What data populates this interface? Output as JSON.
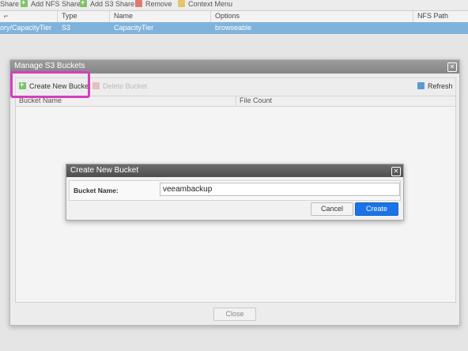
{
  "toolbar": {
    "items": [
      {
        "label": "Share",
        "icon": "none"
      },
      {
        "label": "Add NFS Share",
        "icon": "add-icon"
      },
      {
        "label": "Add S3 Share",
        "icon": "add-icon"
      },
      {
        "label": "Remove",
        "icon": "remove-icon"
      },
      {
        "label": "Context Menu",
        "icon": "menu-icon"
      }
    ]
  },
  "table": {
    "columns": [
      "⌐",
      "Type",
      "Name",
      "Options",
      "NFS Path"
    ],
    "rows": [
      {
        "path": "ory/CapacityTier",
        "type": "S3",
        "name": "CapacityTier",
        "options": "browseable",
        "nfs_path": ""
      }
    ]
  },
  "manage_dialog": {
    "title": "Manage S3 Buckets",
    "create_label": "Create New Bucket",
    "delete_label": "Delete Bucket",
    "refresh_label": "Refresh",
    "columns": [
      "Bucket Name",
      "File Count"
    ],
    "close_label": "Close"
  },
  "create_dialog": {
    "title": "Create New Bucket",
    "field_label": "Bucket Name:",
    "field_value": "veeambackup",
    "cancel_label": "Cancel",
    "create_label": "Create"
  },
  "colors": {
    "selection": "#7fb3dc",
    "highlight": "#d63dbd",
    "primary": "#1a73e8"
  }
}
